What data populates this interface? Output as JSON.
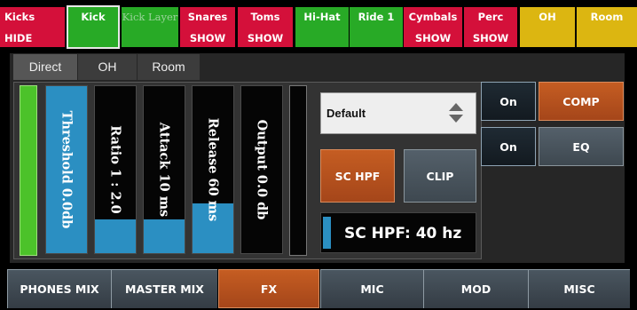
{
  "channels": [
    {
      "name": "Kicks",
      "state": "HIDE",
      "color": "#d4103a"
    },
    {
      "name": "Kick",
      "state": "",
      "color": "#28aa26"
    },
    {
      "name": "Kick Layer",
      "state": "",
      "color": "#28aa26"
    },
    {
      "name": "Snares",
      "state": "SHOW",
      "color": "#d4103a"
    },
    {
      "name": "Toms",
      "state": "SHOW",
      "color": "#d4103a"
    },
    {
      "name": "Hi-Hat",
      "state": "",
      "color": "#28aa26"
    },
    {
      "name": "Ride 1",
      "state": "",
      "color": "#28aa26"
    },
    {
      "name": "Cymbals",
      "state": "SHOW",
      "color": "#d4103a"
    },
    {
      "name": "Perc",
      "state": "SHOW",
      "color": "#d4103a"
    },
    {
      "name": "OH",
      "state": "",
      "color": "#dcb611"
    },
    {
      "name": "Room",
      "state": "",
      "color": "#dcb611"
    }
  ],
  "tabs": [
    "Direct",
    "OH",
    "Room"
  ],
  "compressor": {
    "threshold": {
      "label": "Threshold 0.0db",
      "level": 1.0
    },
    "ratio": {
      "label": "Ratio 1 : 2.0",
      "level": 0.2
    },
    "attack": {
      "label": "Attack 10 ms",
      "level": 0.2
    },
    "release": {
      "label": "Release 60 ms",
      "level": 0.3
    },
    "output": {
      "label": "Output 0.0 db",
      "level": 0.0
    }
  },
  "preset": {
    "value": "Default"
  },
  "buttons": {
    "sc_hpf": "SC HPF",
    "clip": "CLIP",
    "comp_on": "On",
    "comp": "COMP",
    "eq_on": "On",
    "eq": "EQ"
  },
  "sc_hpf_readout": {
    "text": "SC HPF: 40 hz",
    "level": 0.05
  },
  "bottom_nav": [
    "PHONES MIX",
    "MASTER MIX",
    "FX",
    "MIC",
    "MOD",
    "MISC"
  ],
  "colors": {
    "accent_orange": "#b54f1d",
    "fader_blue": "#2b8fc2",
    "meter_green": "#4cc22a"
  }
}
